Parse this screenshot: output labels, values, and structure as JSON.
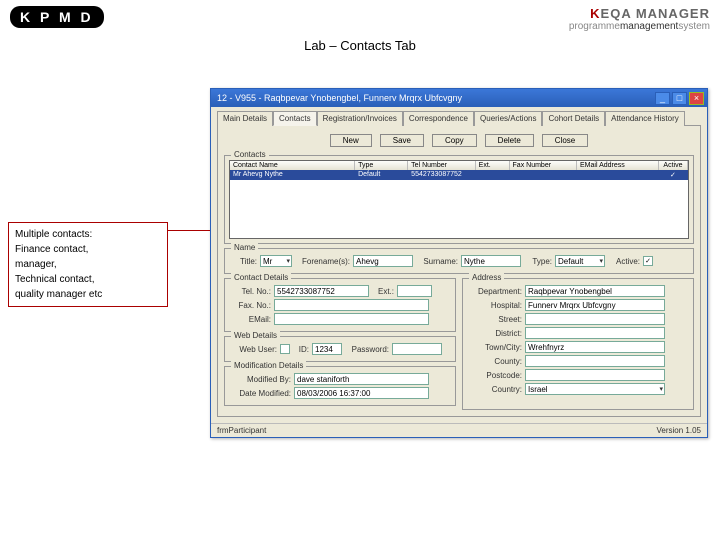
{
  "header": {
    "kpmd": "K P M D",
    "brand_top_prefix": "K",
    "brand_top_rest": "EQA MANAGER",
    "brand_bottom_1": "programme",
    "brand_bottom_2": "management",
    "brand_bottom_3": "system"
  },
  "page_title": "Lab – Contacts Tab",
  "window": {
    "title": "12 - V955 - Raqbpevar Ynobengbel, Funnerv Mrqrx Ubfcvgny"
  },
  "tabs": {
    "t0": "Main Details",
    "t1": "Contacts",
    "t2": "Registration/Invoices",
    "t3": "Correspondence",
    "t4": "Queries/Actions",
    "t5": "Cohort Details",
    "t6": "Attendance History"
  },
  "toolbar": {
    "new": "New",
    "save": "Save",
    "copy": "Copy",
    "delete": "Delete",
    "close": "Close"
  },
  "contacts": {
    "legend": "Contacts",
    "cols": {
      "name": "Contact Name",
      "type": "Type",
      "tel": "Tel Number",
      "ext": "Ext.",
      "fax": "Fax Number",
      "email": "EMail Address",
      "active": "Active"
    },
    "row": {
      "name": "Mr Ahevg Nythe",
      "type": "Default",
      "tel": "5542733087752",
      "ext": "",
      "fax": "",
      "email": "",
      "active": "✓"
    }
  },
  "name": {
    "legend": "Name",
    "title_label": "Title:",
    "title": "Mr",
    "fore_label": "Forename(s):",
    "fore": "Ahevg",
    "sur_label": "Surname:",
    "sur": "Nythe",
    "type_label": "Type:",
    "type": "Default",
    "active_label": "Active:",
    "active": "✓"
  },
  "contact_details": {
    "legend": "Contact Details",
    "tel_label": "Tel. No.:",
    "tel": "5542733087752",
    "ext_label": "Ext.:",
    "ext": "",
    "fax_label": "Fax. No.:",
    "fax": "",
    "email_label": "EMail:",
    "email": ""
  },
  "web": {
    "legend": "Web Details",
    "user_label": "Web User:",
    "user_chk": "",
    "id_label": "ID:",
    "id": "1234",
    "pw_label": "Password:",
    "pw": ""
  },
  "mod": {
    "legend": "Modification Details",
    "by_label": "Modified By:",
    "by": "dave staniforth",
    "date_label": "Date Modified:",
    "date": "08/03/2006 16:37:00"
  },
  "address": {
    "legend": "Address",
    "dept_label": "Department:",
    "dept": "Raqbpevar Ynobengbel",
    "hosp_label": "Hospital:",
    "hosp": "Funnerv Mrqrx Ubfcvgny",
    "street_label": "Street:",
    "street": "",
    "district_label": "District:",
    "district": "",
    "town_label": "Town/City:",
    "town": "Wrehfnyrz",
    "county_label": "County:",
    "county": "",
    "postcode_label": "Postcode:",
    "postcode": "",
    "country_label": "Country:",
    "country": "Israel"
  },
  "status": {
    "left": "frmParticipant",
    "right": "Version 1.05"
  },
  "callout": {
    "l1": "Multiple contacts:",
    "l2": "Finance contact,",
    "l3": "manager,",
    "l4": "Technical contact,",
    "l5": "quality manager etc"
  }
}
